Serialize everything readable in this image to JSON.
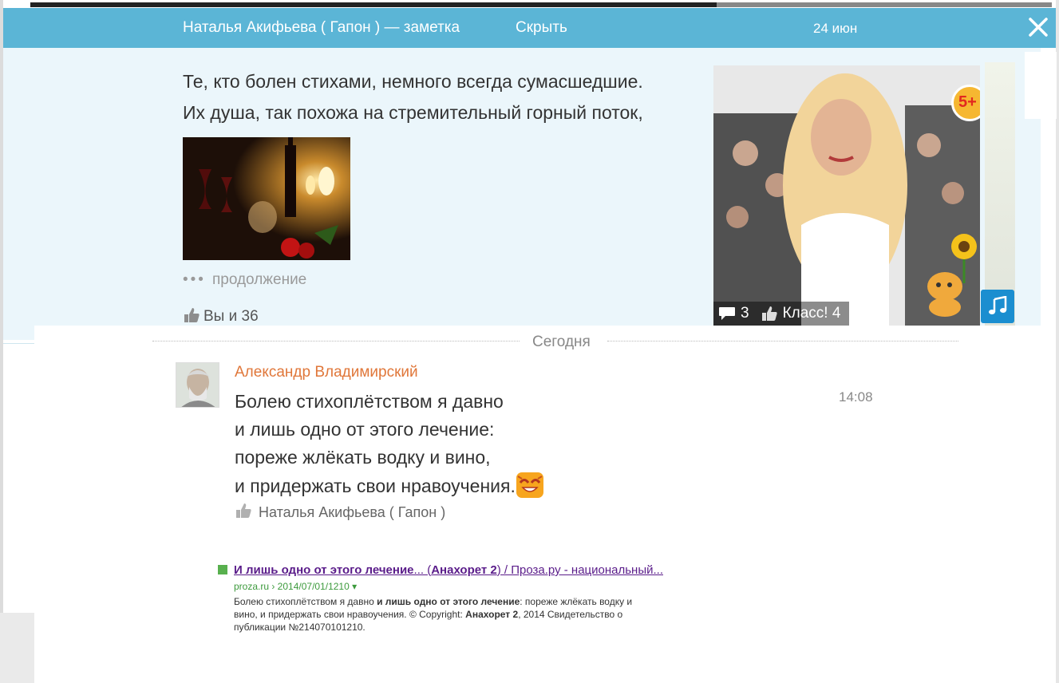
{
  "header": {
    "author_title": "Наталья Акифьева ( Гапон ) — заметка",
    "hide_label": "Скрыть",
    "date": "24 июн"
  },
  "note": {
    "lines": [
      "Те, кто болен стихами, немного всегда сумасшедшие.",
      "Их душа, так похожа на стремительный горный поток,"
    ],
    "more_label": "продолжение",
    "likes_label": "Вы и 36"
  },
  "photo": {
    "comments_count": "3",
    "class_label": "Класс! 4",
    "age_badge": "5+"
  },
  "day_separator": "Сегодня",
  "comment": {
    "author": "Александр Владимирский",
    "time": "14:08",
    "lines": [
      "Болею стихоплётством я давно",
      "и лишь одно от этого лечение:",
      "пореже жлёкать водку и вино,",
      "и придержать свои нравоучения."
    ],
    "liked_by": "Наталья Акифьева ( Гапон )"
  },
  "snippet": {
    "title_bold": "И лишь одно от этого лечение",
    "title_mid": "... (",
    "title_bold2": "Анахорет 2",
    "title_rest": ") / Проза.ру - национальный...",
    "url": "proza.ru › 2014/07/01/1210 ▾",
    "desc_1": "Болею стихоплётством я давно ",
    "desc_2": "и лишь одно от этого лечение",
    "desc_3": ": пореже жлёкать водку и вино, и придержать свои нравоучения. © Copyright: ",
    "desc_4": "Анахорет 2",
    "desc_5": ", 2014 Свидетельство о публикации №214070101210."
  },
  "colors": {
    "header_bg": "#5bb5d6",
    "note_bg": "#ebf6fb",
    "author_accent": "#e0773a",
    "link_visited": "#5a1c8a",
    "url_green": "#3d9a3d"
  }
}
